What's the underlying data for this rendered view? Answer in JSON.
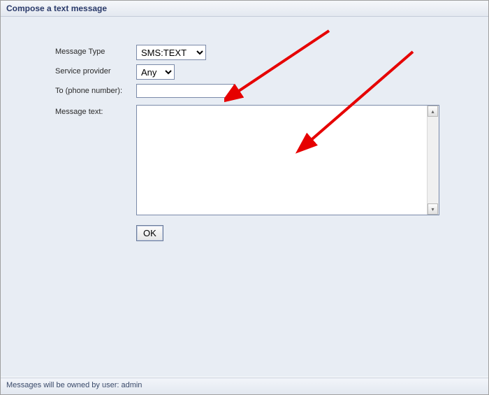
{
  "title": "Compose a text message",
  "form": {
    "message_type_label": "Message Type",
    "message_type_value": "SMS:TEXT",
    "service_provider_label": "Service provider",
    "service_provider_value": "Any",
    "to_label": "To (phone number):",
    "to_value": "",
    "message_text_label": "Message text:",
    "message_text_value": "",
    "ok_label": "OK"
  },
  "footer": "Messages will be owned by user: admin"
}
